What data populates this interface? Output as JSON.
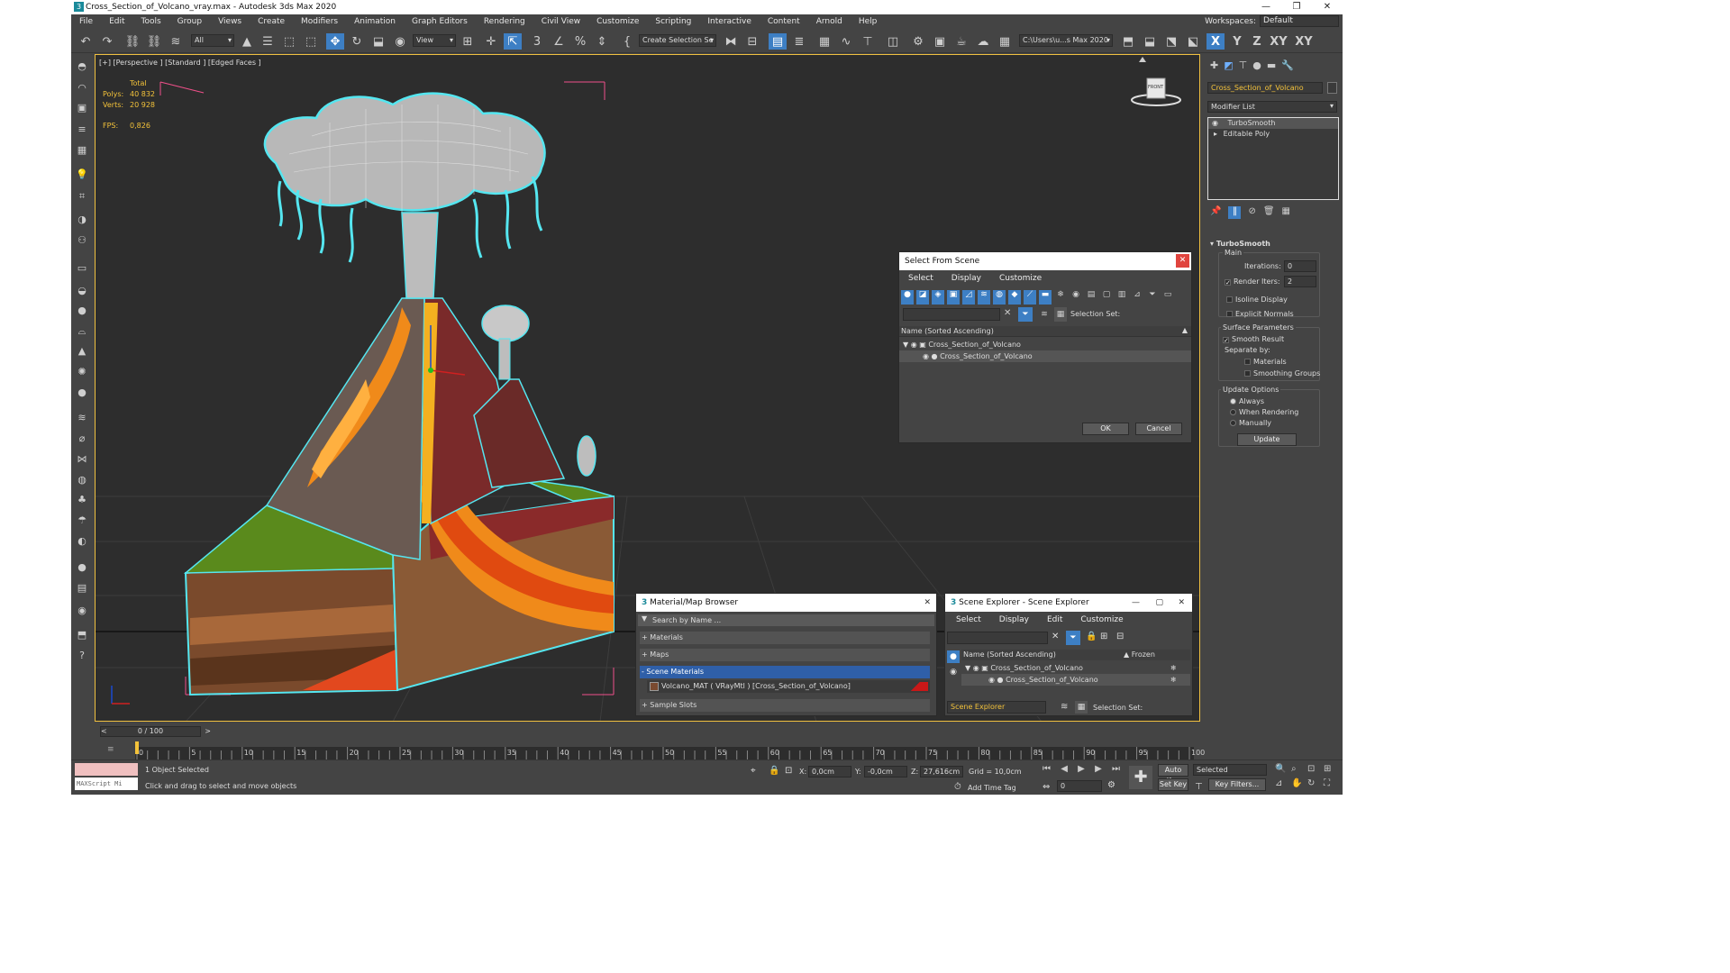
{
  "window": {
    "title": "Cross_Section_of_Volcano_vray.max - Autodesk 3ds Max 2020"
  },
  "menu": [
    "File",
    "Edit",
    "Tools",
    "Group",
    "Views",
    "Create",
    "Modifiers",
    "Animation",
    "Graph Editors",
    "Rendering",
    "Civil View",
    "Customize",
    "Scripting",
    "Interactive",
    "Content",
    "Arnold",
    "Help"
  ],
  "workspace": {
    "label": "Workspaces:",
    "value": "Default"
  },
  "toolbar": {
    "filter_value": "All",
    "ref_coord": "View",
    "selection_set_placeholder": "Create Selection Se",
    "project_path": "C:\\Users\\u...s Max 2020",
    "axis_x": "X",
    "axis_y": "Y",
    "axis_z": "Z",
    "axis_xy": "XY",
    "axis_xy2": "XY"
  },
  "viewport": {
    "label": "[+] [Perspective ] [Standard ] [Edged Faces ]",
    "stats": {
      "total": "Total",
      "polys_label": "Polys:",
      "polys": "40 832",
      "verts_label": "Verts:",
      "verts": "20 928",
      "fps_label": "FPS:",
      "fps": "0,826"
    },
    "viewcube_label": "FRONT"
  },
  "select_from_scene": {
    "title": "Select From Scene",
    "menu": [
      "Select",
      "Display",
      "Customize"
    ],
    "selection_set_label": "Selection Set:",
    "column_header": "Name (Sorted Ascending)",
    "rows": [
      "Cross_Section_of_Volcano",
      "Cross_Section_of_Volcano"
    ],
    "ok": "OK",
    "cancel": "Cancel"
  },
  "material_browser": {
    "title": "Material/Map Browser",
    "search_placeholder": "Search by Name ...",
    "sections": [
      "+ Materials",
      "+ Maps",
      "- Scene Materials"
    ],
    "material_item": "Volcano_MAT ( VRayMtl ) [Cross_Section_of_Volcano]",
    "sample_slots": "+ Sample Slots"
  },
  "scene_explorer": {
    "title": "Scene Explorer - Scene Explorer",
    "menu": [
      "Select",
      "Display",
      "Edit",
      "Customize"
    ],
    "column_header": "Name (Sorted Ascending)",
    "column_frozen": "▲ Frozen",
    "rows": [
      "Cross_Section_of_Volcano",
      "Cross_Section_of_Volcano"
    ],
    "explorer_name": "Scene Explorer",
    "selection_set_label": "Selection Set:"
  },
  "command_panel": {
    "object_name": "Cross_Section_of_Volcano",
    "modifier_list": "Modifier List",
    "modifiers": [
      "TurboSmooth",
      "Editable Poly"
    ],
    "rollout_title": "TurboSmooth",
    "main_label": "Main",
    "iterations_label": "Iterations:",
    "iterations": "0",
    "render_iters_label": "Render Iters:",
    "render_iters": "2",
    "isoline_display": "Isoline Display",
    "explicit_normals": "Explicit Normals",
    "surface_params": "Surface Parameters",
    "smooth_result": "Smooth Result",
    "separate_by": "Separate by:",
    "materials": "Materials",
    "smoothing_groups": "Smoothing Groups",
    "update_options": "Update Options",
    "always": "Always",
    "when_rendering": "When Rendering",
    "manually": "Manually",
    "update_button": "Update"
  },
  "timeline": {
    "frame_counter": "0 / 100",
    "ticks": [
      "0",
      "5",
      "10",
      "15",
      "20",
      "25",
      "30",
      "35",
      "40",
      "45",
      "50",
      "55",
      "60",
      "65",
      "70",
      "75",
      "80",
      "85",
      "90",
      "95",
      "100"
    ]
  },
  "status": {
    "maxscript": "MAXScript Mi",
    "selected": "1 Object Selected",
    "hint": "Click and drag to select and move objects",
    "x_label": "X:",
    "x": "0,0cm",
    "y_label": "Y:",
    "y": "-0,0cm",
    "z_label": "Z:",
    "z": "27,616cm",
    "grid": "Grid = 10,0cm",
    "add_time_tag": "Add Time Tag",
    "auto_key": "Auto Key",
    "set_key": "Set Key",
    "selected_dropdown": "Selected",
    "key_filters": "Key Filters...",
    "frame_field": "0"
  },
  "colors": {
    "accent_yellow": "#f3c23a",
    "selection_cyan": "#55e6f0",
    "active_blue": "#3d7fc4"
  }
}
